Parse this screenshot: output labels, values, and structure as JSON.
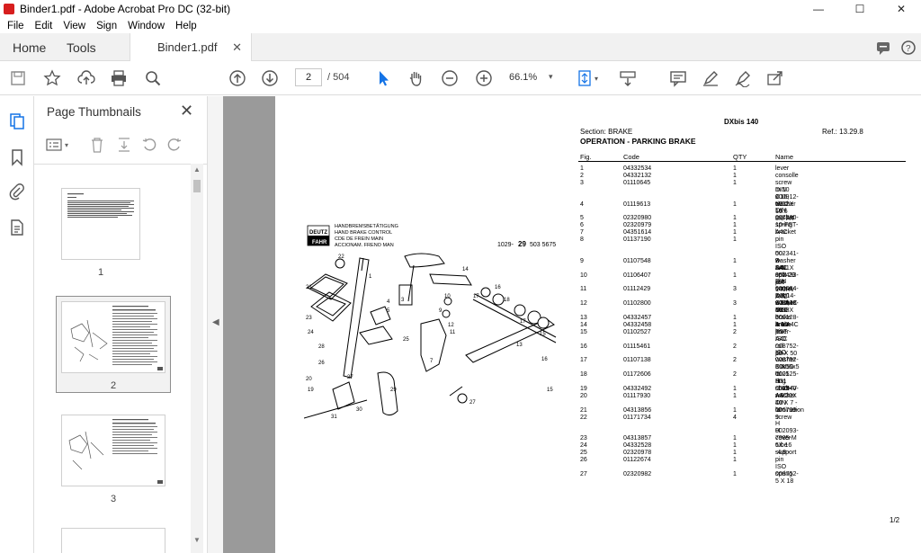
{
  "window": {
    "title": "Binder1.pdf - Adobe Acrobat Pro DC (32-bit)",
    "minimize": "—",
    "maximize": "☐",
    "close": "✕"
  },
  "menu": [
    "File",
    "Edit",
    "View",
    "Sign",
    "Window",
    "Help"
  ],
  "tabs": {
    "home": "Home",
    "tools": "Tools",
    "document": "Binder1.pdf",
    "doc_close": "✕"
  },
  "toolbar": {
    "page_current": "2",
    "page_total": "/ 504",
    "zoom": "66.1%"
  },
  "thumbnails": {
    "title": "Page Thumbnails",
    "close": "✕",
    "pages": [
      "1",
      "2",
      "3"
    ]
  },
  "document": {
    "model": "DXbis 140",
    "section": "Section: BRAKE",
    "ref": "Ref.: 13.29.8",
    "heading": "OPERATION - PARKING BRAKE",
    "cols": [
      "Fig.",
      "Code",
      "QTY",
      "Name"
    ],
    "page_num": "1/2",
    "diagram": {
      "line1": "HANDBREMSBETÄTIGUNG",
      "line2": "HAND  BRAKE  CONTROL",
      "line3": "CDE  DE  FREIN  MAIN",
      "line4": "ACCIONAM.  FRENO  MAN",
      "logo1": "DEUTZ",
      "logo2": "FAHR",
      "partno_prefix": "1029-",
      "partno_mid": "29",
      "partno_suffix": "503  5675"
    },
    "rows": [
      {
        "fig": "1",
        "code": "04332534",
        "qty": "1",
        "name": "lever"
      },
      {
        "fig": "2",
        "code": "04332132",
        "qty": "1",
        "name": "consolle"
      },
      {
        "fig": "3",
        "code": "01110645",
        "qty": "1",
        "name": "screw m 10 x 16, d912"
      },
      {
        "fig": "",
        "code": "",
        "qty": "",
        "name": "DIN 000912- M10 X 16 - 8.8-A4"
      },
      {
        "fig": "",
        "code": "",
        "qty": "",
        "name": "C"
      },
      {
        "fig": "4",
        "code": "01119613",
        "qty": "1",
        "name": "washer 10.5"
      },
      {
        "fig": "",
        "code": "",
        "qty": "",
        "name": "DIN 007980-10-FST-A4C"
      },
      {
        "fig": "5",
        "code": "02320980",
        "qty": "1",
        "name": "ratchet"
      },
      {
        "fig": "6",
        "code": "02320979",
        "qty": "1",
        "name": "spring"
      },
      {
        "fig": "7",
        "code": "04351614",
        "qty": "1",
        "name": "bracket"
      },
      {
        "fig": "8",
        "code": "01137190",
        "qty": "1",
        "name": "pin"
      },
      {
        "fig": "",
        "code": "",
        "qty": "",
        "name": "ISO 002341-B 8A11X 35X 29 -ST"
      },
      {
        "fig": "",
        "code": "",
        "qty": "",
        "name": "50-2-A4C"
      },
      {
        "fig": "9",
        "code": "01107548",
        "qty": "1",
        "name": "washer 8.4"
      },
      {
        "fig": "",
        "code": "",
        "qty": "",
        "name": "DIN 000433- 8.4-140HV-A4C"
      },
      {
        "fig": "10",
        "code": "01106407",
        "qty": "1",
        "name": "split pin"
      },
      {
        "fig": "",
        "code": "",
        "qty": "",
        "name": "DIN 000094- 2 X 14-ST-A4C"
      },
      {
        "fig": "11",
        "code": "01112429",
        "qty": "3",
        "name": "screw m 10 x 30, d933"
      },
      {
        "fig": "",
        "code": "",
        "qty": "",
        "name": "DIN 000933-M10 X 30 - 8.8-A4C"
      },
      {
        "fig": "12",
        "code": "01102800",
        "qty": "3",
        "name": "washer 10.2"
      },
      {
        "fig": "",
        "code": "",
        "qty": "",
        "name": "DIN 000128-A 10 -FST -A4C"
      },
      {
        "fig": "13",
        "code": "04332457",
        "qty": "1",
        "name": "brake lever"
      },
      {
        "fig": "14",
        "code": "04332458",
        "qty": "1",
        "name": "brake lever"
      },
      {
        "fig": "15",
        "code": "01102527",
        "qty": "2",
        "name": "pin"
      },
      {
        "fig": "",
        "code": "",
        "qty": "",
        "name": "ISO 008752-10 X 50"
      },
      {
        "fig": "16",
        "code": "01115461",
        "qty": "2",
        "name": "roll pin"
      },
      {
        "fig": "",
        "code": "",
        "qty": "",
        "name": "ISO 008752- 6 X 50"
      },
      {
        "fig": "17",
        "code": "01107138",
        "qty": "2",
        "name": "washer 31x56x5 d125"
      },
      {
        "fig": "",
        "code": "",
        "qty": "",
        "name": "DIN 000125-B31 -140HV-A4C"
      },
      {
        "fig": "18",
        "code": "01172606",
        "qty": "2",
        "name": "'o' ring"
      },
      {
        "fig": "",
        "code": "",
        "qty": "",
        "name": "H 002940-AS 30X 40 X 7 -NI"
      },
      {
        "fig": "19",
        "code": "04332492",
        "qty": "1",
        "name": "shaft"
      },
      {
        "fig": "20",
        "code": "01117930",
        "qty": "1",
        "name": "washer"
      },
      {
        "fig": "",
        "code": "",
        "qty": "",
        "name": "DIN 006799- 9"
      },
      {
        "fig": "21",
        "code": "04313856",
        "qty": "1",
        "name": "lamination"
      },
      {
        "fig": "22",
        "code": "01171734",
        "qty": "4",
        "name": "screw"
      },
      {
        "fig": "",
        "code": "",
        "qty": "",
        "name": "H 002093- 7985-M 6X 16 -4.8 -"
      },
      {
        "fig": "",
        "code": "",
        "qty": "",
        "name": "H"
      },
      {
        "fig": "23",
        "code": "04313857",
        "qty": "1",
        "name": "cover"
      },
      {
        "fig": "24",
        "code": "04332528",
        "qty": "1",
        "name": "tube"
      },
      {
        "fig": "25",
        "code": "02320978",
        "qty": "1",
        "name": "support"
      },
      {
        "fig": "26",
        "code": "01122674",
        "qty": "1",
        "name": "pin"
      },
      {
        "fig": "",
        "code": "",
        "qty": "",
        "name": "ISO 008752- 5 X 18"
      },
      {
        "fig": "27",
        "code": "02320982",
        "qty": "1",
        "name": "spring"
      }
    ]
  }
}
